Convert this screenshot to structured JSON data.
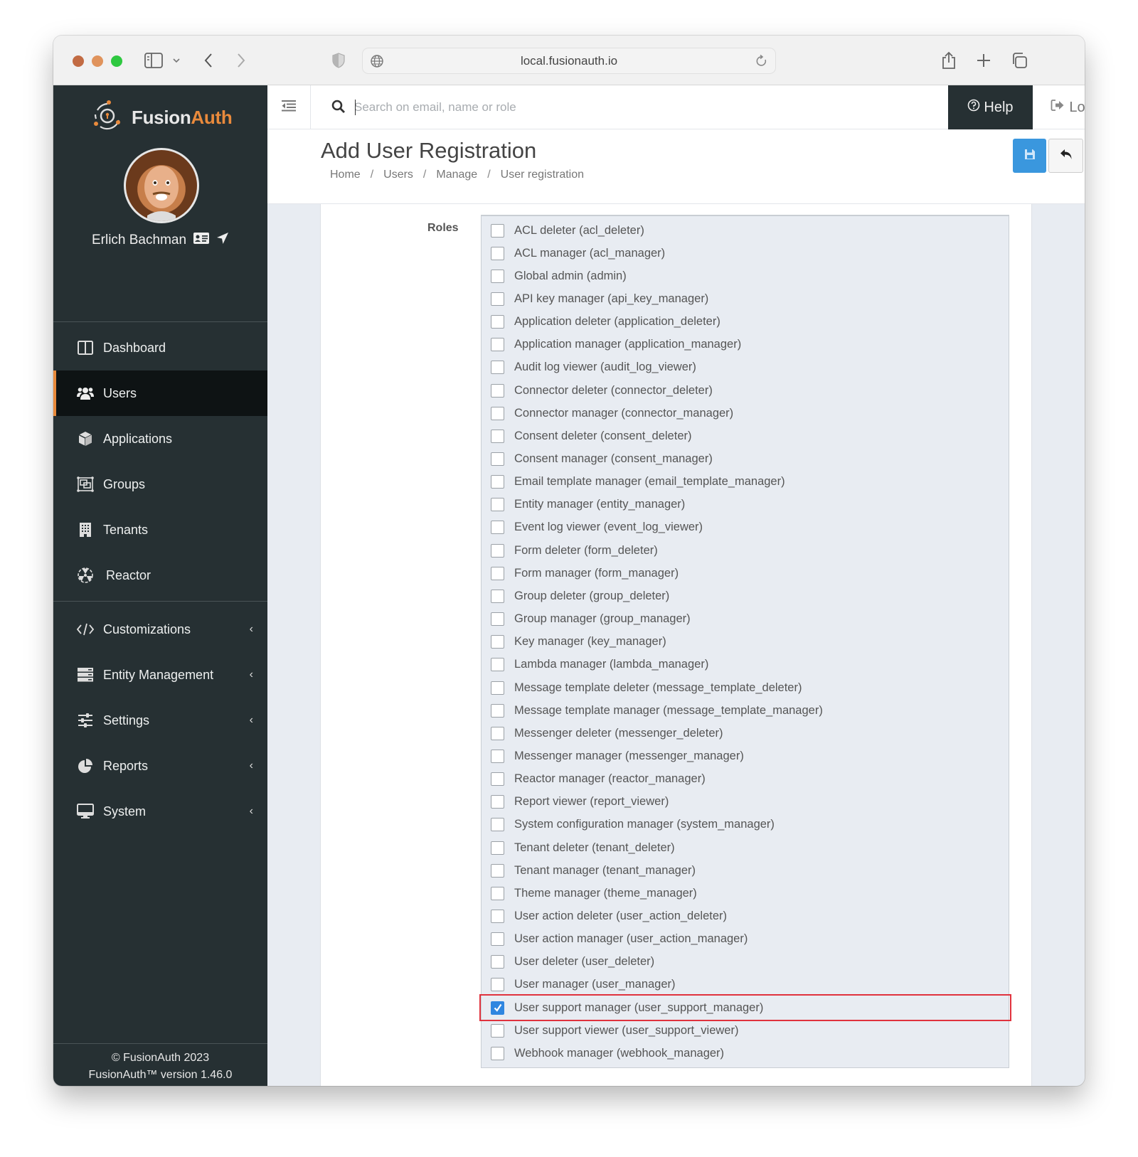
{
  "browser": {
    "url": "local.fusionauth.io"
  },
  "sidebar": {
    "logo": {
      "fusion": "Fusion",
      "auth": "Auth"
    },
    "user_name": "Erlich Bachman",
    "items": [
      {
        "label": "Dashboard",
        "icon": "dashboard-icon",
        "active": false
      },
      {
        "label": "Users",
        "icon": "users-icon",
        "active": true
      },
      {
        "label": "Applications",
        "icon": "cube-icon",
        "active": false
      },
      {
        "label": "Groups",
        "icon": "groups-icon",
        "active": false
      },
      {
        "label": "Tenants",
        "icon": "building-icon",
        "active": false
      },
      {
        "label": "Reactor",
        "icon": "reactor-icon",
        "active": false
      }
    ],
    "expandable": [
      {
        "label": "Customizations",
        "icon": "code-icon"
      },
      {
        "label": "Entity Management",
        "icon": "server-icon"
      },
      {
        "label": "Settings",
        "icon": "sliders-icon"
      },
      {
        "label": "Reports",
        "icon": "pie-chart-icon"
      },
      {
        "label": "System",
        "icon": "desktop-icon"
      }
    ],
    "footer": {
      "copyright": "© FusionAuth 2023",
      "version": "FusionAuth™ version 1.46.0"
    }
  },
  "topnav": {
    "search_placeholder": "Search on email, name or role",
    "search_value": "",
    "help_label": "Help",
    "logout_label": "Logout"
  },
  "header": {
    "title": "Add User Registration",
    "breadcrumb": [
      "Home",
      "Users",
      "Manage",
      "User registration"
    ]
  },
  "form": {
    "roles_label": "Roles",
    "roles": [
      {
        "label": "ACL deleter (acl_deleter)",
        "checked": false
      },
      {
        "label": "ACL manager (acl_manager)",
        "checked": false
      },
      {
        "label": "Global admin (admin)",
        "checked": false
      },
      {
        "label": "API key manager (api_key_manager)",
        "checked": false
      },
      {
        "label": "Application deleter (application_deleter)",
        "checked": false
      },
      {
        "label": "Application manager (application_manager)",
        "checked": false
      },
      {
        "label": "Audit log viewer (audit_log_viewer)",
        "checked": false
      },
      {
        "label": "Connector deleter (connector_deleter)",
        "checked": false
      },
      {
        "label": "Connector manager (connector_manager)",
        "checked": false
      },
      {
        "label": "Consent deleter (consent_deleter)",
        "checked": false
      },
      {
        "label": "Consent manager (consent_manager)",
        "checked": false
      },
      {
        "label": "Email template manager (email_template_manager)",
        "checked": false
      },
      {
        "label": "Entity manager (entity_manager)",
        "checked": false
      },
      {
        "label": "Event log viewer (event_log_viewer)",
        "checked": false
      },
      {
        "label": "Form deleter (form_deleter)",
        "checked": false
      },
      {
        "label": "Form manager (form_manager)",
        "checked": false
      },
      {
        "label": "Group deleter (group_deleter)",
        "checked": false
      },
      {
        "label": "Group manager (group_manager)",
        "checked": false
      },
      {
        "label": "Key manager (key_manager)",
        "checked": false
      },
      {
        "label": "Lambda manager (lambda_manager)",
        "checked": false
      },
      {
        "label": "Message template deleter (message_template_deleter)",
        "checked": false
      },
      {
        "label": "Message template manager (message_template_manager)",
        "checked": false
      },
      {
        "label": "Messenger deleter (messenger_deleter)",
        "checked": false
      },
      {
        "label": "Messenger manager (messenger_manager)",
        "checked": false
      },
      {
        "label": "Reactor manager (reactor_manager)",
        "checked": false
      },
      {
        "label": "Report viewer (report_viewer)",
        "checked": false
      },
      {
        "label": "System configuration manager (system_manager)",
        "checked": false
      },
      {
        "label": "Tenant deleter (tenant_deleter)",
        "checked": false
      },
      {
        "label": "Tenant manager (tenant_manager)",
        "checked": false
      },
      {
        "label": "Theme manager (theme_manager)",
        "checked": false
      },
      {
        "label": "User action deleter (user_action_deleter)",
        "checked": false
      },
      {
        "label": "User action manager (user_action_manager)",
        "checked": false
      },
      {
        "label": "User deleter (user_deleter)",
        "checked": false
      },
      {
        "label": "User manager (user_manager)",
        "checked": false
      },
      {
        "label": "User support manager (user_support_manager)",
        "checked": true,
        "highlighted": true
      },
      {
        "label": "User support viewer (user_support_viewer)",
        "checked": false
      },
      {
        "label": "Webhook manager (webhook_manager)",
        "checked": false
      }
    ]
  },
  "colors": {
    "sidebar_bg": "#263033",
    "accent_orange": "#e98a3c",
    "primary_blue": "#3a97de",
    "highlight_red": "#e0323d"
  }
}
